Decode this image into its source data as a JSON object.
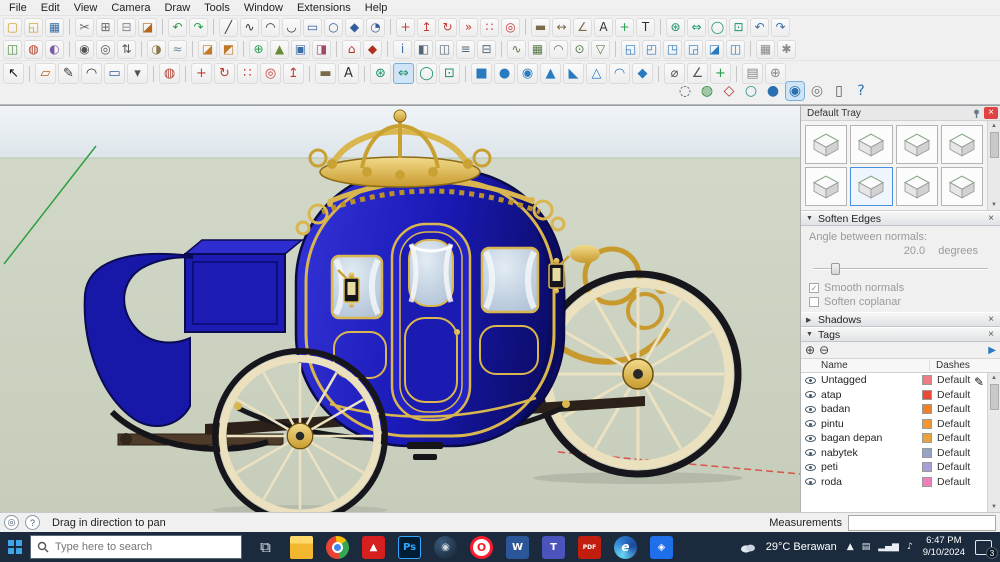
{
  "menu": {
    "items": [
      "File",
      "Edit",
      "View",
      "Camera",
      "Draw",
      "Tools",
      "Window",
      "Extensions",
      "Help"
    ]
  },
  "icons": {
    "scroll_up": "▲",
    "scroll_down": "▼",
    "section_expanded": "▼",
    "section_collapsed": "▶",
    "close": "×",
    "check": "✓",
    "pencil": "✎",
    "add_tag": "⊕",
    "remove_tag": "⊖",
    "tags_detail": "▶",
    "help": "?",
    "geolocate": "◎"
  },
  "toolbars": {
    "row1": [
      {
        "n": "new-file-icon",
        "g": "▢",
        "c": "#c8a028"
      },
      {
        "n": "open-file-icon",
        "g": "◱",
        "c": "#c8a028"
      },
      {
        "n": "save-file-icon",
        "g": "▦",
        "c": "#3a6ea5"
      },
      {
        "sep": true
      },
      {
        "n": "cut-icon",
        "g": "✂",
        "c": "#666666"
      },
      {
        "n": "copy-icon",
        "g": "⊞",
        "c": "#666666"
      },
      {
        "n": "paste-icon",
        "g": "⊟",
        "c": "#888888"
      },
      {
        "n": "erase-icon",
        "g": "◪",
        "c": "#b5651d"
      },
      {
        "sep": true
      },
      {
        "n": "undo-icon",
        "g": "↶",
        "c": "#2a9d4a"
      },
      {
        "n": "redo-icon",
        "g": "↷",
        "c": "#2a9d4a"
      },
      {
        "sep": true
      },
      {
        "n": "line-icon",
        "g": "╱",
        "c": "#333333"
      },
      {
        "n": "freehand-icon",
        "g": "∿",
        "c": "#333333"
      },
      {
        "n": "arc-icon",
        "g": "◠",
        "c": "#333333"
      },
      {
        "n": "two-point-arc-icon",
        "g": "◡",
        "c": "#333333"
      },
      {
        "n": "rectangle-icon",
        "g": "▭",
        "c": "#335e9e"
      },
      {
        "n": "circle-icon",
        "g": "○",
        "c": "#335e9e"
      },
      {
        "n": "polygon-icon",
        "g": "◆",
        "c": "#335e9e"
      },
      {
        "n": "pie-icon",
        "g": "◔",
        "c": "#335e9e"
      },
      {
        "sep": true
      },
      {
        "n": "move-icon",
        "g": "+",
        "c": "#c23b33"
      },
      {
        "n": "push-pull-icon",
        "g": "↥",
        "c": "#c23b33"
      },
      {
        "n": "rotate-icon",
        "g": "↻",
        "c": "#c23b33"
      },
      {
        "n": "follow-me-icon",
        "g": "»",
        "c": "#c23b33"
      },
      {
        "n": "scale-icon",
        "g": "∷",
        "c": "#c23b33"
      },
      {
        "n": "offset-icon",
        "g": "◎",
        "c": "#c23b33"
      },
      {
        "sep": true
      },
      {
        "n": "tape-measure-icon",
        "g": "▬",
        "c": "#7a6a4a"
      },
      {
        "n": "dimension-icon",
        "g": "↔",
        "c": "#7a6a4a"
      },
      {
        "n": "protractor-icon",
        "g": "∠",
        "c": "#7a6a4a"
      },
      {
        "n": "text-icon",
        "g": "A",
        "c": "#333333"
      },
      {
        "n": "axes-icon",
        "g": "+",
        "c": "#2a9d4a"
      },
      {
        "n": "3d-text-icon",
        "g": "T",
        "c": "#333333"
      },
      {
        "sep": true
      },
      {
        "n": "orbit-icon",
        "g": "⊛",
        "c": "#1a8f6a"
      },
      {
        "n": "pan-icon",
        "g": "⇔",
        "c": "#1a8f6a"
      },
      {
        "n": "zoom-icon",
        "g": "◯",
        "c": "#1a8f6a"
      },
      {
        "n": "zoom-extents-icon",
        "g": "⊡",
        "c": "#1a8f6a"
      },
      {
        "n": "previous-view-icon",
        "g": "↶",
        "c": "#3a6ea5"
      },
      {
        "n": "next-view-icon",
        "g": "↷",
        "c": "#3a6ea5"
      }
    ],
    "row2": [
      {
        "n": "make-component-icon",
        "g": "◫",
        "c": "#4a8a3a"
      },
      {
        "n": "paint-bucket-icon",
        "g": "◍",
        "c": "#b04030"
      },
      {
        "n": "styles-icon",
        "g": "◐",
        "c": "#7a5aa0"
      },
      {
        "sep": true
      },
      {
        "n": "position-camera-icon",
        "g": "◉",
        "c": "#555555"
      },
      {
        "n": "look-around-icon",
        "g": "◎",
        "c": "#555555"
      },
      {
        "n": "walk-icon",
        "g": "⇅",
        "c": "#555555"
      },
      {
        "sep": true
      },
      {
        "n": "shadows-toggle-icon",
        "g": "◑",
        "c": "#8a7a4a"
      },
      {
        "n": "fog-icon",
        "g": "≈",
        "c": "#7a8aa0"
      },
      {
        "sep": true
      },
      {
        "n": "section-plane-icon",
        "g": "◪",
        "c": "#c07828"
      },
      {
        "n": "section-fill-icon",
        "g": "◩",
        "c": "#c07828"
      },
      {
        "sep": true
      },
      {
        "n": "add-location-icon",
        "g": "⊕",
        "c": "#2a9d4a"
      },
      {
        "n": "toggle-terrain-icon",
        "g": "▲",
        "c": "#6a8a3a"
      },
      {
        "n": "photo-texture-icon",
        "g": "▣",
        "c": "#3a6ea5"
      },
      {
        "n": "match-photo-icon",
        "g": "◨",
        "c": "#a04a6a"
      },
      {
        "sep": true
      },
      {
        "n": "3d-warehouse-icon",
        "g": "⌂",
        "c": "#b03020"
      },
      {
        "n": "extension-warehouse-icon",
        "g": "◆",
        "c": "#b03020"
      },
      {
        "sep": true
      },
      {
        "n": "entity-info-icon",
        "g": "i",
        "c": "#3a6ea5"
      },
      {
        "n": "materials-icon",
        "g": "◧",
        "c": "#556677"
      },
      {
        "n": "components-icon",
        "g": "◫",
        "c": "#556677"
      },
      {
        "n": "layers-icon",
        "g": "≡",
        "c": "#556677"
      },
      {
        "n": "outliner-icon",
        "g": "⊟",
        "c": "#556677"
      },
      {
        "sep": true
      },
      {
        "n": "from-contours-icon",
        "g": "∿",
        "c": "#5a7a4a"
      },
      {
        "n": "from-scratch-icon",
        "g": "▦",
        "c": "#5a7a4a"
      },
      {
        "n": "smoove-icon",
        "g": "◠",
        "c": "#5a7a4a"
      },
      {
        "n": "stamp-icon",
        "g": "⊙",
        "c": "#5a7a4a"
      },
      {
        "n": "drape-icon",
        "g": "▽",
        "c": "#5a7a4a"
      },
      {
        "sep": true
      },
      {
        "n": "outer-shell-icon",
        "g": "◱",
        "c": "#2a7ac0"
      },
      {
        "n": "solid-intersect-icon",
        "g": "◰",
        "c": "#2a7ac0"
      },
      {
        "n": "solid-union-icon",
        "g": "◳",
        "c": "#2a7ac0"
      },
      {
        "n": "solid-subtract-icon",
        "g": "◲",
        "c": "#2a7ac0"
      },
      {
        "n": "solid-trim-icon",
        "g": "◪",
        "c": "#2a7ac0"
      },
      {
        "n": "solid-split-icon",
        "g": "◫",
        "c": "#2a7ac0"
      },
      {
        "sep": true
      },
      {
        "n": "grid-icon",
        "g": "▦",
        "c": "#888888"
      },
      {
        "n": "settings-gear-icon",
        "g": "✱",
        "c": "#888888"
      }
    ],
    "row3": [
      {
        "n": "select-icon",
        "g": "↖",
        "c": "#111111"
      },
      {
        "sep": true
      },
      {
        "n": "eraser-icon",
        "g": "▱",
        "c": "#b5651d"
      },
      {
        "n": "pencil-tool-icon",
        "g": "✎",
        "c": "#333333"
      },
      {
        "n": "arc-tool-icon",
        "g": "◠",
        "c": "#333333"
      },
      {
        "n": "shapes-tool-icon",
        "g": "▭",
        "c": "#335e9e"
      },
      {
        "n": "shapes-dropdown-icon",
        "g": "▾",
        "c": "#555555"
      },
      {
        "sep": true
      },
      {
        "n": "paint-tool-icon",
        "g": "◍",
        "c": "#b04030"
      },
      {
        "sep": true
      },
      {
        "n": "move-tool-icon",
        "g": "+",
        "c": "#c23b33"
      },
      {
        "n": "rotate-tool-icon",
        "g": "↻",
        "c": "#c23b33"
      },
      {
        "n": "scale-tool-icon",
        "g": "∷",
        "c": "#c23b33"
      },
      {
        "n": "offset-tool-icon",
        "g": "◎",
        "c": "#c23b33"
      },
      {
        "n": "push-pull-tool-icon",
        "g": "↥",
        "c": "#c23b33"
      },
      {
        "sep": true
      },
      {
        "n": "tape-tool-icon",
        "g": "▬",
        "c": "#7a6a4a"
      },
      {
        "n": "text-tool-icon",
        "g": "A",
        "c": "#333333"
      },
      {
        "sep": true
      },
      {
        "n": "orbit-tool-icon",
        "g": "⊛",
        "c": "#1a8f6a"
      },
      {
        "n": "pan-tool-icon",
        "g": "⇔",
        "c": "#1a8f6a",
        "active": true
      },
      {
        "n": "zoom-tool-icon",
        "g": "◯",
        "c": "#1a8f6a"
      },
      {
        "n": "zoom-extents-tool-icon",
        "g": "⊡",
        "c": "#1a8f6a"
      },
      {
        "sep": true
      },
      {
        "n": "box-solid-icon",
        "g": "■",
        "c": "#2a7ac0"
      },
      {
        "n": "cylinder-solid-icon",
        "g": "●",
        "c": "#2a7ac0"
      },
      {
        "n": "sphere-solid-icon",
        "g": "◉",
        "c": "#2a7ac0"
      },
      {
        "n": "cone-solid-icon",
        "g": "▲",
        "c": "#2a7ac0"
      },
      {
        "n": "wedge-solid-icon",
        "g": "◣",
        "c": "#2a7ac0"
      },
      {
        "n": "pyramid-solid-icon",
        "g": "△",
        "c": "#2a7ac0"
      },
      {
        "n": "dome-solid-icon",
        "g": "◠",
        "c": "#2a7ac0"
      },
      {
        "n": "prism-solid-icon",
        "g": "◆",
        "c": "#2a7ac0"
      },
      {
        "sep": true
      },
      {
        "n": "measure-tool-icon",
        "g": "⌀",
        "c": "#555555"
      },
      {
        "n": "protractor-tool-icon",
        "g": "∠",
        "c": "#555555"
      },
      {
        "n": "axes-tool-icon",
        "g": "+",
        "c": "#2a9d4a"
      },
      {
        "sep": true
      },
      {
        "n": "print-3d-icon",
        "g": "▤",
        "c": "#888888"
      },
      {
        "n": "hand-tool-icon",
        "g": "⊕",
        "c": "#888888"
      }
    ],
    "styles": [
      {
        "n": "x-ray-icon",
        "g": "◌",
        "c": "#445566"
      },
      {
        "n": "back-edges-icon",
        "g": "◍",
        "c": "#2e8b3a"
      },
      {
        "n": "wireframe-icon",
        "g": "◇",
        "c": "#b03028"
      },
      {
        "n": "hidden-line-icon",
        "g": "○",
        "c": "#2a8f8f"
      },
      {
        "n": "shaded-icon",
        "g": "●",
        "c": "#2a6fb0"
      },
      {
        "n": "shaded-textures-icon",
        "g": "◉",
        "c": "#2a6fb0",
        "active": true
      },
      {
        "n": "monochrome-icon",
        "g": "◎",
        "c": "#777777"
      },
      {
        "n": "ruler-hud-icon",
        "g": "▯",
        "c": "#555555"
      },
      {
        "n": "instructor-icon",
        "g": "?",
        "c": "#2a6fb0"
      }
    ]
  },
  "tray": {
    "title": "Default Tray",
    "thumbnails": [
      {
        "n": "style-thumbnail-1"
      },
      {
        "n": "style-thumbnail-2"
      },
      {
        "n": "style-thumbnail-3"
      },
      {
        "n": "style-thumbnail-4"
      },
      {
        "n": "style-thumbnail-5"
      },
      {
        "n": "style-thumbnail-6",
        "active": true
      },
      {
        "n": "style-thumbnail-7"
      },
      {
        "n": "style-thumbnail-8"
      }
    ],
    "soften": {
      "title": "Soften Edges",
      "angle_label": "Angle between normals:",
      "angle_value": "20.0",
      "angle_unit": "degrees",
      "cb1": "Smooth normals",
      "cb2": "Soften coplanar"
    },
    "shadows": {
      "title": "Shadows"
    },
    "tags": {
      "title": "Tags",
      "col_name": "Name",
      "col_dashes": "Dashes",
      "rows": [
        {
          "name": "Untagged",
          "dashes": "Default",
          "color": "#ef7b84"
        },
        {
          "name": "atap",
          "dashes": "Default",
          "color": "#e84b31"
        },
        {
          "name": "badan",
          "dashes": "Default",
          "color": "#ee7f2d"
        },
        {
          "name": "pintu",
          "dashes": "Default",
          "color": "#f0982f"
        },
        {
          "name": "bagan depan",
          "dashes": "Default",
          "color": "#e8a33c"
        },
        {
          "name": "nabytek",
          "dashes": "Default",
          "color": "#93a5c4"
        },
        {
          "name": "peti",
          "dashes": "Default",
          "color": "#a99fd4"
        },
        {
          "name": "roda",
          "dashes": "Default",
          "color": "#f07fb9"
        }
      ]
    }
  },
  "statusbar": {
    "hint": "Drag in direction to pan",
    "measurements_label": "Measurements",
    "measurements_value": ""
  },
  "taskbar": {
    "search_placeholder": "Type here to search",
    "apps": [
      {
        "n": "task-view-icon",
        "g": "⧉",
        "cls": "plain",
        "fg": "#e8eef4"
      },
      {
        "n": "file-explorer-icon",
        "cls": "folder",
        "g": ""
      },
      {
        "n": "chrome-icon",
        "cls": "chrome",
        "g": ""
      },
      {
        "n": "acrobat-icon",
        "c": "#d6201f",
        "g": "▲",
        "fg": "#ffffff"
      },
      {
        "n": "photoshop-icon",
        "cls": "ps",
        "g": "Ps",
        "fg": "#31a8ff"
      },
      {
        "n": "steam-icon",
        "cls": "steam",
        "g": "◉",
        "fg": "#cfd8e0"
      },
      {
        "n": "opera-icon",
        "cls": "opera",
        "g": "O",
        "fg": "#ff1b2d"
      },
      {
        "n": "word-icon",
        "c": "#2b579a",
        "g": "W",
        "fg": "#ffffff"
      },
      {
        "n": "teams-icon",
        "c": "#4b53bc",
        "g": "T",
        "fg": "#ffffff"
      },
      {
        "n": "pdf-reader-icon",
        "c": "#c11e0f",
        "g": "PDF",
        "fg": "#ffffff",
        "cls": "tiny"
      },
      {
        "n": "edge-icon",
        "cls": "edge",
        "g": "e",
        "fg": "#ffffff"
      },
      {
        "n": "photos-icon",
        "c": "#1f6feb",
        "g": "◈",
        "fg": "#ffffff"
      }
    ],
    "tray_icons": [
      {
        "n": "chevron-up-icon",
        "g": "▲"
      },
      {
        "n": "touch-keyboard-icon",
        "g": "▤"
      },
      {
        "n": "network-icon",
        "g": "▂▄▆"
      },
      {
        "n": "volume-icon",
        "g": "♪"
      }
    ],
    "weather": {
      "temp": "29°C",
      "desc": "Berawan"
    },
    "clock": {
      "time": "6:47 PM",
      "date": "9/10/2024"
    },
    "badge": "3"
  }
}
